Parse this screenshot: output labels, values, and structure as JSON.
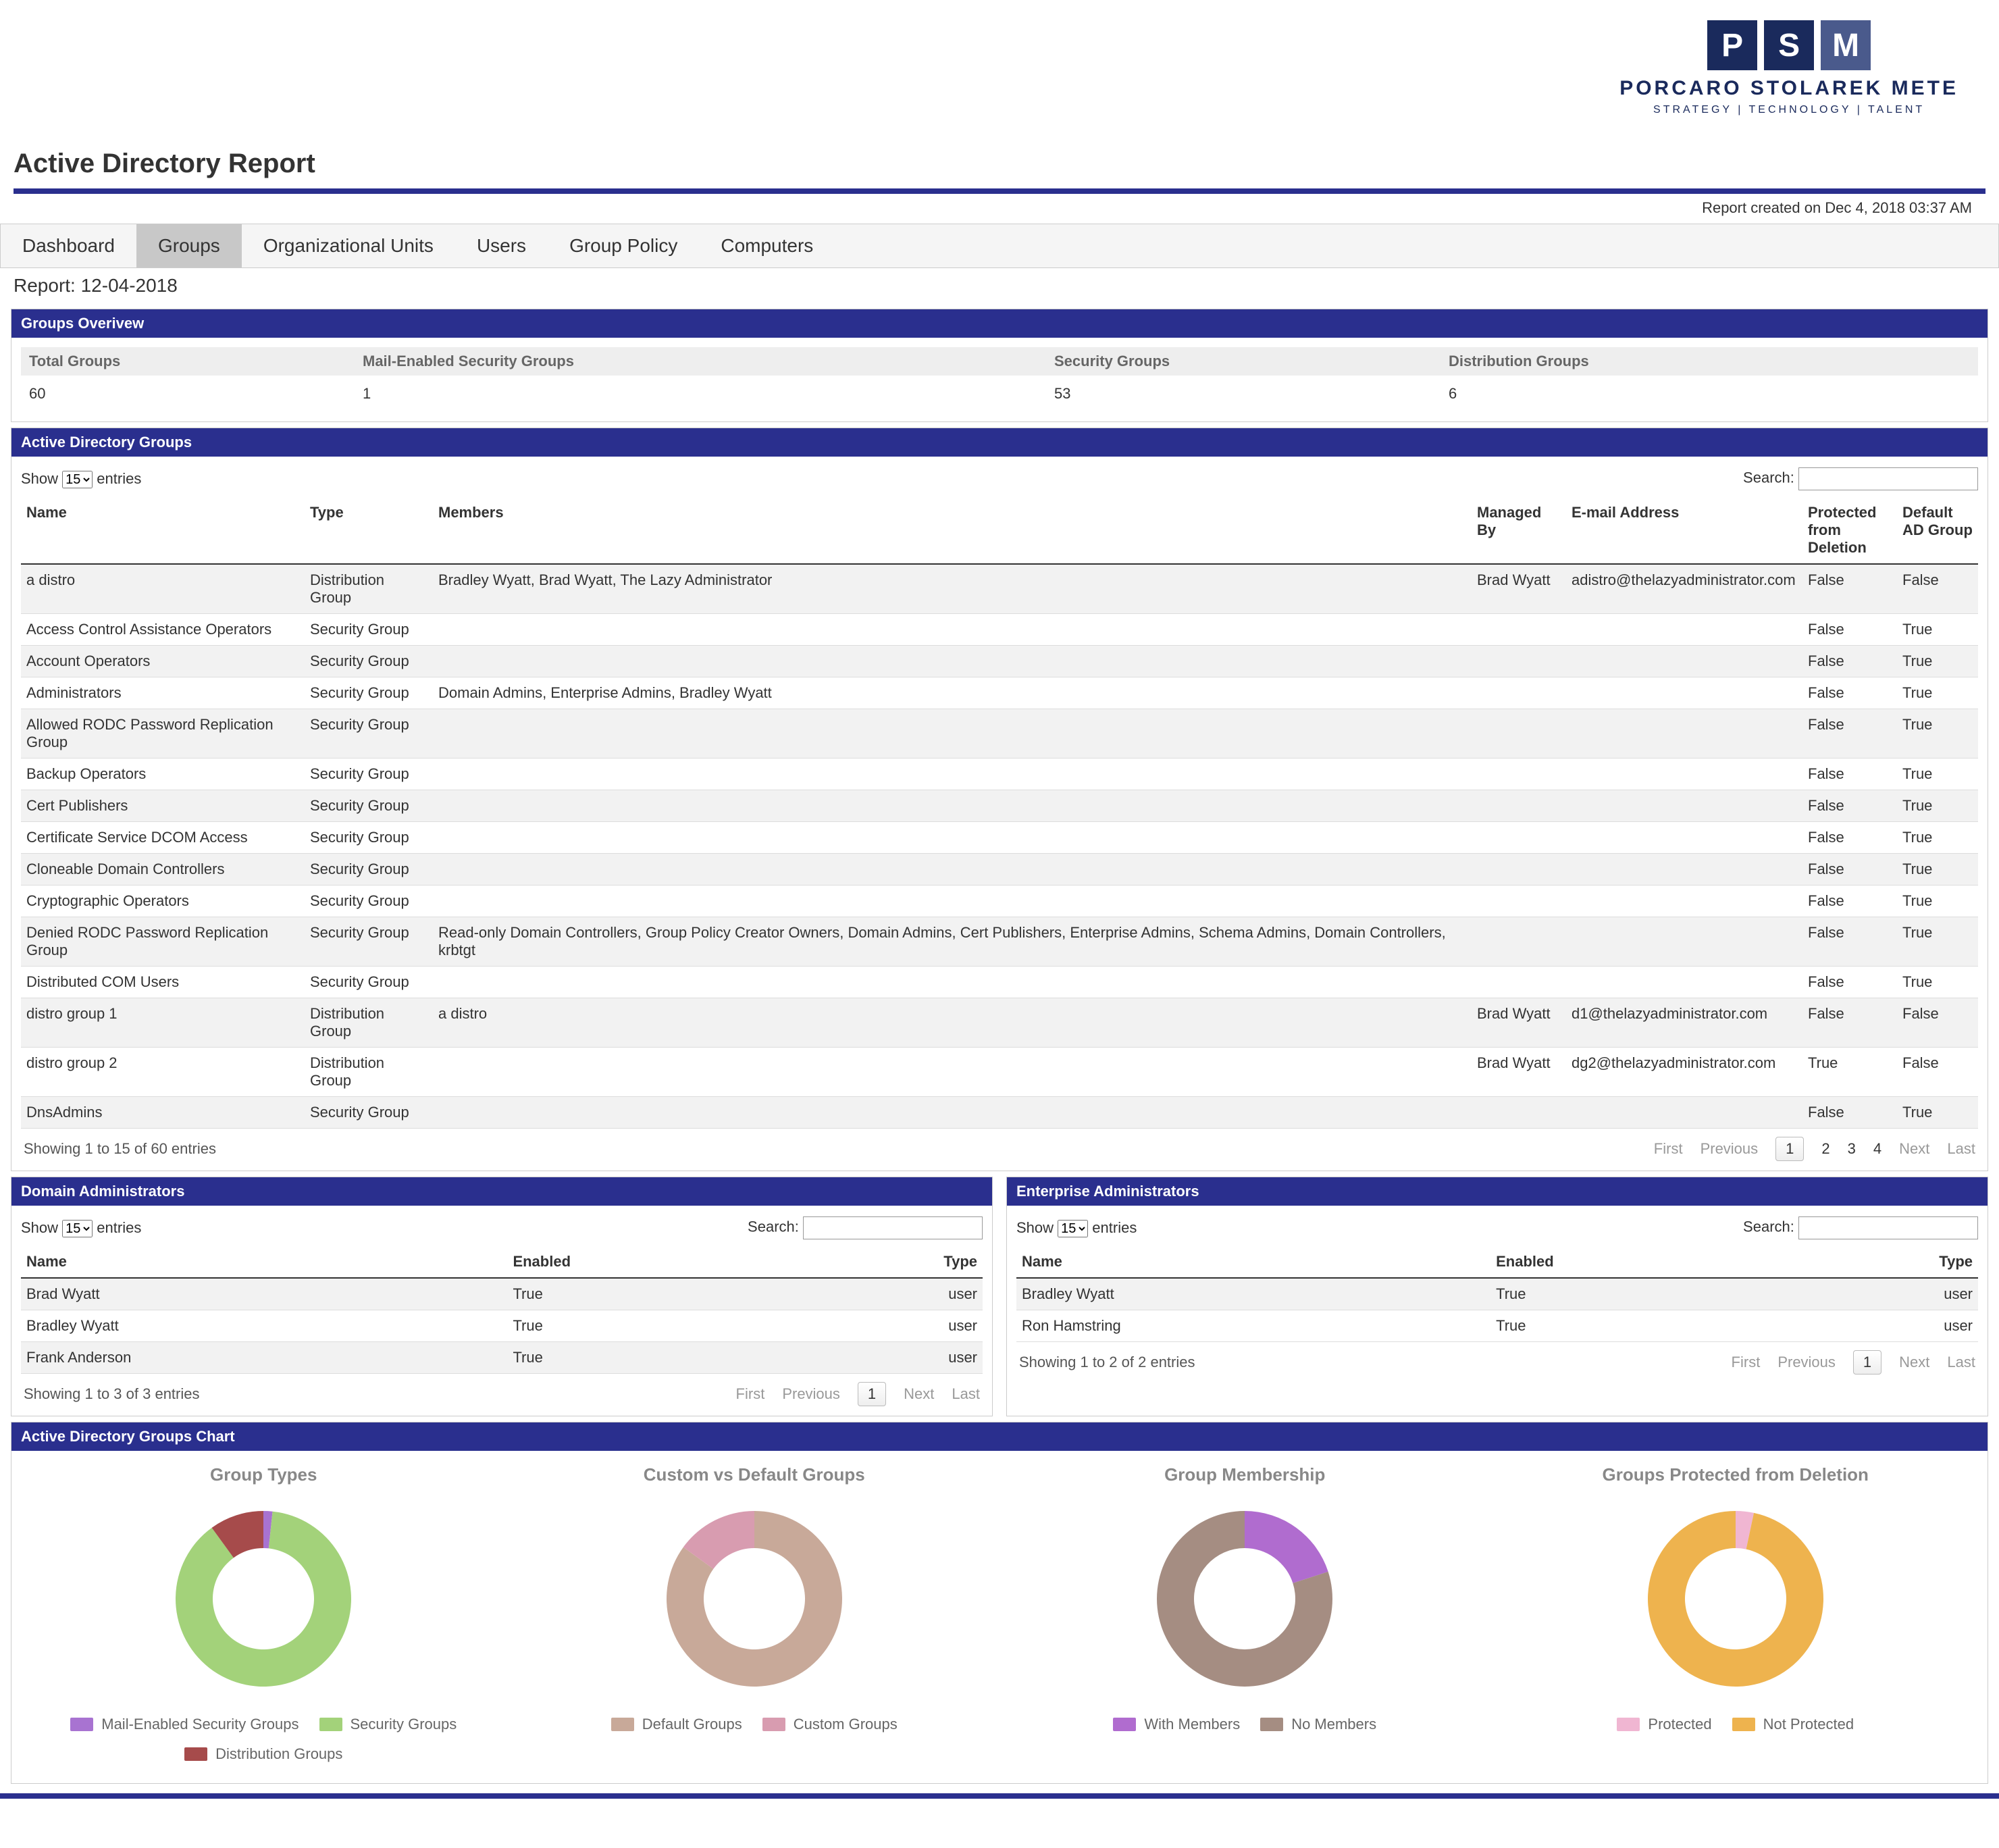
{
  "logo": {
    "letters": [
      "P",
      "S",
      "M"
    ],
    "name": "PORCARO STOLAREK METE",
    "sub": "STRATEGY | TECHNOLOGY | TALENT"
  },
  "page_title": "Active Directory Report",
  "created_on": "Report created on Dec 4, 2018 03:37 AM",
  "tabs": [
    "Dashboard",
    "Groups",
    "Organizational Units",
    "Users",
    "Group Policy",
    "Computers"
  ],
  "active_tab": 1,
  "report_label": "Report: 12-04-2018",
  "overview": {
    "title": "Groups Overivew",
    "headers": [
      "Total Groups",
      "Mail-Enabled Security Groups",
      "Security Groups",
      "Distribution Groups"
    ],
    "values": [
      "60",
      "1",
      "53",
      "6"
    ]
  },
  "ad_groups": {
    "title": "Active Directory Groups",
    "show_label": "Show",
    "entries_label": "entries",
    "page_size": "15",
    "search_label": "Search:",
    "columns": [
      "Name",
      "Type",
      "Members",
      "Managed By",
      "E-mail Address",
      "Protected from Deletion",
      "Default AD Group"
    ],
    "rows": [
      {
        "name": "a distro",
        "type": "Distribution Group",
        "members": "Bradley Wyatt, Brad Wyatt, The Lazy Administrator",
        "managed": "Brad Wyatt",
        "email": "adistro@thelazyadministrator.com",
        "protected": "False",
        "default": "False"
      },
      {
        "name": "Access Control Assistance Operators",
        "type": "Security Group",
        "members": "",
        "managed": "",
        "email": "",
        "protected": "False",
        "default": "True"
      },
      {
        "name": "Account Operators",
        "type": "Security Group",
        "members": "",
        "managed": "",
        "email": "",
        "protected": "False",
        "default": "True"
      },
      {
        "name": "Administrators",
        "type": "Security Group",
        "members": "Domain Admins, Enterprise Admins, Bradley Wyatt",
        "managed": "",
        "email": "",
        "protected": "False",
        "default": "True"
      },
      {
        "name": "Allowed RODC Password Replication Group",
        "type": "Security Group",
        "members": "",
        "managed": "",
        "email": "",
        "protected": "False",
        "default": "True"
      },
      {
        "name": "Backup Operators",
        "type": "Security Group",
        "members": "",
        "managed": "",
        "email": "",
        "protected": "False",
        "default": "True"
      },
      {
        "name": "Cert Publishers",
        "type": "Security Group",
        "members": "",
        "managed": "",
        "email": "",
        "protected": "False",
        "default": "True"
      },
      {
        "name": "Certificate Service DCOM Access",
        "type": "Security Group",
        "members": "",
        "managed": "",
        "email": "",
        "protected": "False",
        "default": "True"
      },
      {
        "name": "Cloneable Domain Controllers",
        "type": "Security Group",
        "members": "",
        "managed": "",
        "email": "",
        "protected": "False",
        "default": "True"
      },
      {
        "name": "Cryptographic Operators",
        "type": "Security Group",
        "members": "",
        "managed": "",
        "email": "",
        "protected": "False",
        "default": "True"
      },
      {
        "name": "Denied RODC Password Replication Group",
        "type": "Security Group",
        "members": "Read-only Domain Controllers, Group Policy Creator Owners, Domain Admins, Cert Publishers, Enterprise Admins, Schema Admins, Domain Controllers, krbtgt",
        "managed": "",
        "email": "",
        "protected": "False",
        "default": "True"
      },
      {
        "name": "Distributed COM Users",
        "type": "Security Group",
        "members": "",
        "managed": "",
        "email": "",
        "protected": "False",
        "default": "True"
      },
      {
        "name": "distro group 1",
        "type": "Distribution Group",
        "members": "a distro",
        "managed": "Brad Wyatt",
        "email": "d1@thelazyadministrator.com",
        "protected": "False",
        "default": "False"
      },
      {
        "name": "distro group 2",
        "type": "Distribution Group",
        "members": "",
        "managed": "Brad Wyatt",
        "email": "dg2@thelazyadministrator.com",
        "protected": "True",
        "default": "False"
      },
      {
        "name": "DnsAdmins",
        "type": "Security Group",
        "members": "",
        "managed": "",
        "email": "",
        "protected": "False",
        "default": "True"
      }
    ],
    "info": "Showing 1 to 15 of 60 entries",
    "pager": {
      "first": "First",
      "prev": "Previous",
      "pages": [
        "1",
        "2",
        "3",
        "4"
      ],
      "next": "Next",
      "last": "Last",
      "current": 0
    }
  },
  "domain_admins": {
    "title": "Domain Administrators",
    "show_label": "Show",
    "entries_label": "entries",
    "page_size": "15",
    "search_label": "Search:",
    "columns": [
      "Name",
      "Enabled",
      "Type"
    ],
    "rows": [
      {
        "name": "Brad Wyatt",
        "enabled": "True",
        "type": "user"
      },
      {
        "name": "Bradley Wyatt",
        "enabled": "True",
        "type": "user"
      },
      {
        "name": "Frank Anderson",
        "enabled": "True",
        "type": "user"
      }
    ],
    "info": "Showing 1 to 3 of 3 entries",
    "pager": {
      "first": "First",
      "prev": "Previous",
      "pages": [
        "1"
      ],
      "next": "Next",
      "last": "Last",
      "current": 0
    }
  },
  "enterprise_admins": {
    "title": "Enterprise Administrators",
    "show_label": "Show",
    "entries_label": "entries",
    "page_size": "15",
    "search_label": "Search:",
    "columns": [
      "Name",
      "Enabled",
      "Type"
    ],
    "rows": [
      {
        "name": "Bradley Wyatt",
        "enabled": "True",
        "type": "user"
      },
      {
        "name": "Ron Hamstring",
        "enabled": "True",
        "type": "user"
      }
    ],
    "info": "Showing 1 to 2 of 2 entries",
    "pager": {
      "first": "First",
      "prev": "Previous",
      "pages": [
        "1"
      ],
      "next": "Next",
      "last": "Last",
      "current": 0
    }
  },
  "charts_panel_title": "Active Directory Groups Chart",
  "chart_data": [
    {
      "type": "pie",
      "title": "Group Types",
      "series": [
        {
          "name": "Mail-Enabled Security Groups",
          "value": 1,
          "color": "#a873d1"
        },
        {
          "name": "Security Groups",
          "value": 53,
          "color": "#a3d27a"
        },
        {
          "name": "Distribution Groups",
          "value": 6,
          "color": "#a64b4b"
        }
      ]
    },
    {
      "type": "pie",
      "title": "Custom vs Default Groups",
      "series": [
        {
          "name": "Default Groups",
          "value": 51,
          "color": "#c8a999"
        },
        {
          "name": "Custom Groups",
          "value": 9,
          "color": "#d89cb0"
        }
      ]
    },
    {
      "type": "pie",
      "title": "Group Membership",
      "series": [
        {
          "name": "With Members",
          "value": 12,
          "color": "#b06ccf"
        },
        {
          "name": "No Members",
          "value": 48,
          "color": "#a58d82"
        }
      ]
    },
    {
      "type": "pie",
      "title": "Groups Protected from Deletion",
      "series": [
        {
          "name": "Protected",
          "value": 2,
          "color": "#f0b6d2"
        },
        {
          "name": "Not Protected",
          "value": 58,
          "color": "#eeb34e"
        }
      ]
    }
  ]
}
